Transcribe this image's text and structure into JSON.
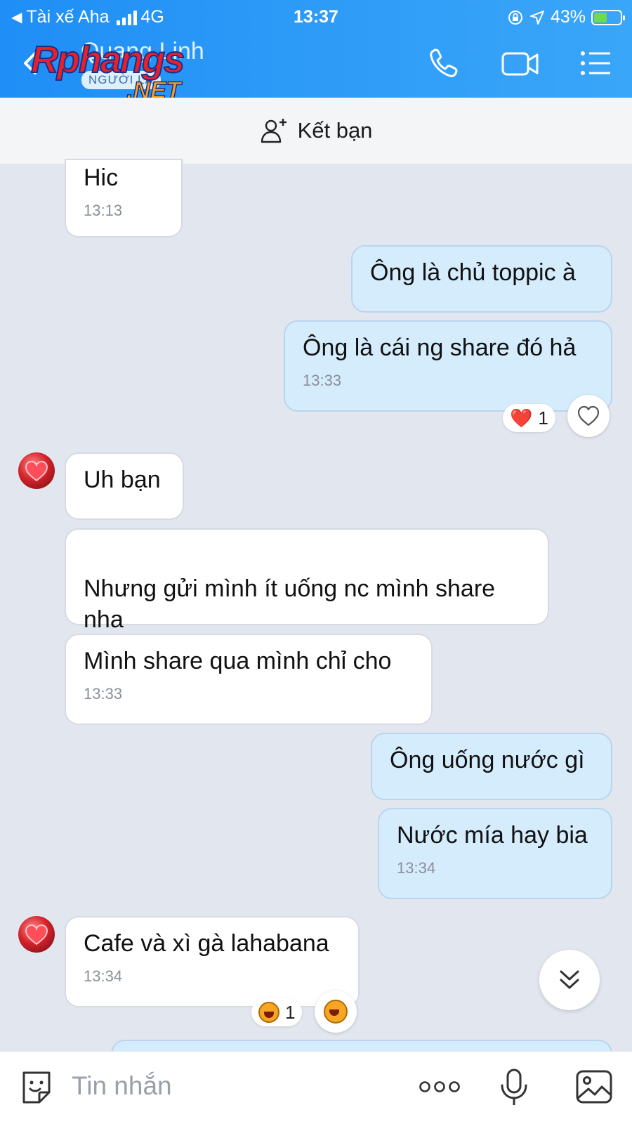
{
  "status_bar": {
    "carrier": "Tài xế Aha",
    "network": "4G",
    "time": "13:37",
    "battery": "43%"
  },
  "header": {
    "contact_name": "Quang Linh",
    "badge": "NGƯỜI LẠ",
    "icons": [
      "back-icon",
      "phone-icon",
      "video-call-icon",
      "menu-list-icon"
    ],
    "watermark": {
      "main": "Rphangs",
      "sub": ".NET"
    }
  },
  "friend_bar": {
    "label": "Kết bạn",
    "icon": "add-friend-icon"
  },
  "messages": [
    {
      "dir": "in",
      "text": "Hic",
      "time": "13:13"
    },
    {
      "dir": "out",
      "text": "Ông là chủ toppic à"
    },
    {
      "dir": "out",
      "text": "Ông là cái ng share đó hả",
      "time": "13:33",
      "reaction": {
        "emoji": "❤️",
        "count": "1"
      }
    },
    {
      "dir": "in",
      "text": "Uh bạn"
    },
    {
      "dir": "in",
      "text": "Nhưng gửi mình ít uống nc mình share\nnha"
    },
    {
      "dir": "in",
      "text": "Mình share qua mình chỉ cho",
      "time": "13:33"
    },
    {
      "dir": "out",
      "text": "Ông uống nước gì"
    },
    {
      "dir": "out",
      "text": "Nước mía hay bia",
      "time": "13:34"
    },
    {
      "dir": "in",
      "text": "Cafe và xì gà lahabana",
      "time": "13:34",
      "reaction": {
        "emoji": "laugh",
        "count": "1"
      }
    }
  ],
  "composer": {
    "placeholder": "Tin nhắn",
    "icons": [
      "sticker-icon",
      "more-dots-icon",
      "microphone-icon",
      "image-icon"
    ]
  },
  "colors": {
    "header_blue": "#2c9af7",
    "outgoing_bubble": "#d5ecfd",
    "incoming_bubble": "#ffffff",
    "chat_background": "#e2e6ee"
  }
}
